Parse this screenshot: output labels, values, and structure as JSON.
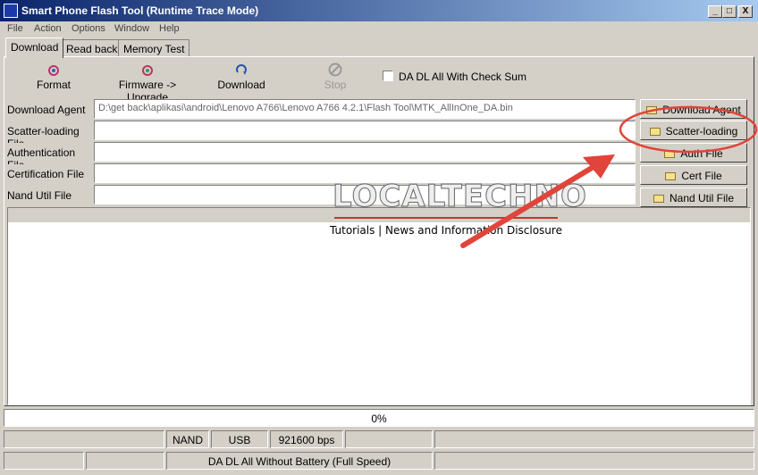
{
  "window": {
    "title": "Smart Phone Flash Tool (Runtime Trace Mode)",
    "minimize": "_",
    "maximize": "□",
    "close": "X"
  },
  "menu": [
    "File",
    "Action",
    "Options",
    "Window",
    "Help"
  ],
  "tabs": [
    "Download",
    "Read back",
    "Memory Test"
  ],
  "toolbar": {
    "format": "Format",
    "firmware_upgrade": "Firmware -> Upgrade",
    "download": "Download",
    "stop": "Stop",
    "da_checksum": "DA DL All With Check Sum"
  },
  "fields": {
    "download_agent": {
      "label": "Download Agent",
      "value": "D:\\get back\\aplikasi\\android\\Lenovo A766\\Lenovo A766 4.2.1\\Flash Tool\\MTK_AllInOne_DA.bin"
    },
    "scatter": {
      "label": "Scatter-loading File",
      "value": ""
    },
    "auth": {
      "label": "Authentication File",
      "value": ""
    },
    "cert": {
      "label": "Certification File",
      "value": ""
    },
    "nand": {
      "label": "Nand Util File",
      "value": ""
    }
  },
  "buttons": {
    "download_agent": "Download Agent",
    "scatter": "Scatter-loading",
    "auth": "Auth File",
    "cert": "Cert File",
    "nand": "Nand Util File"
  },
  "watermark": {
    "brand": "LOCALTECHNO",
    "tagline": "Tutorials | News and Information Disclosure"
  },
  "progress": "0%",
  "status": {
    "row1": [
      "",
      "NAND",
      "USB",
      "921600 bps",
      "",
      ""
    ],
    "row2": [
      "",
      "",
      "DA DL All Without Battery (Full Speed)",
      ""
    ]
  },
  "colors": {
    "titlebar": "#0a246a",
    "annotation": "#e0443a"
  }
}
